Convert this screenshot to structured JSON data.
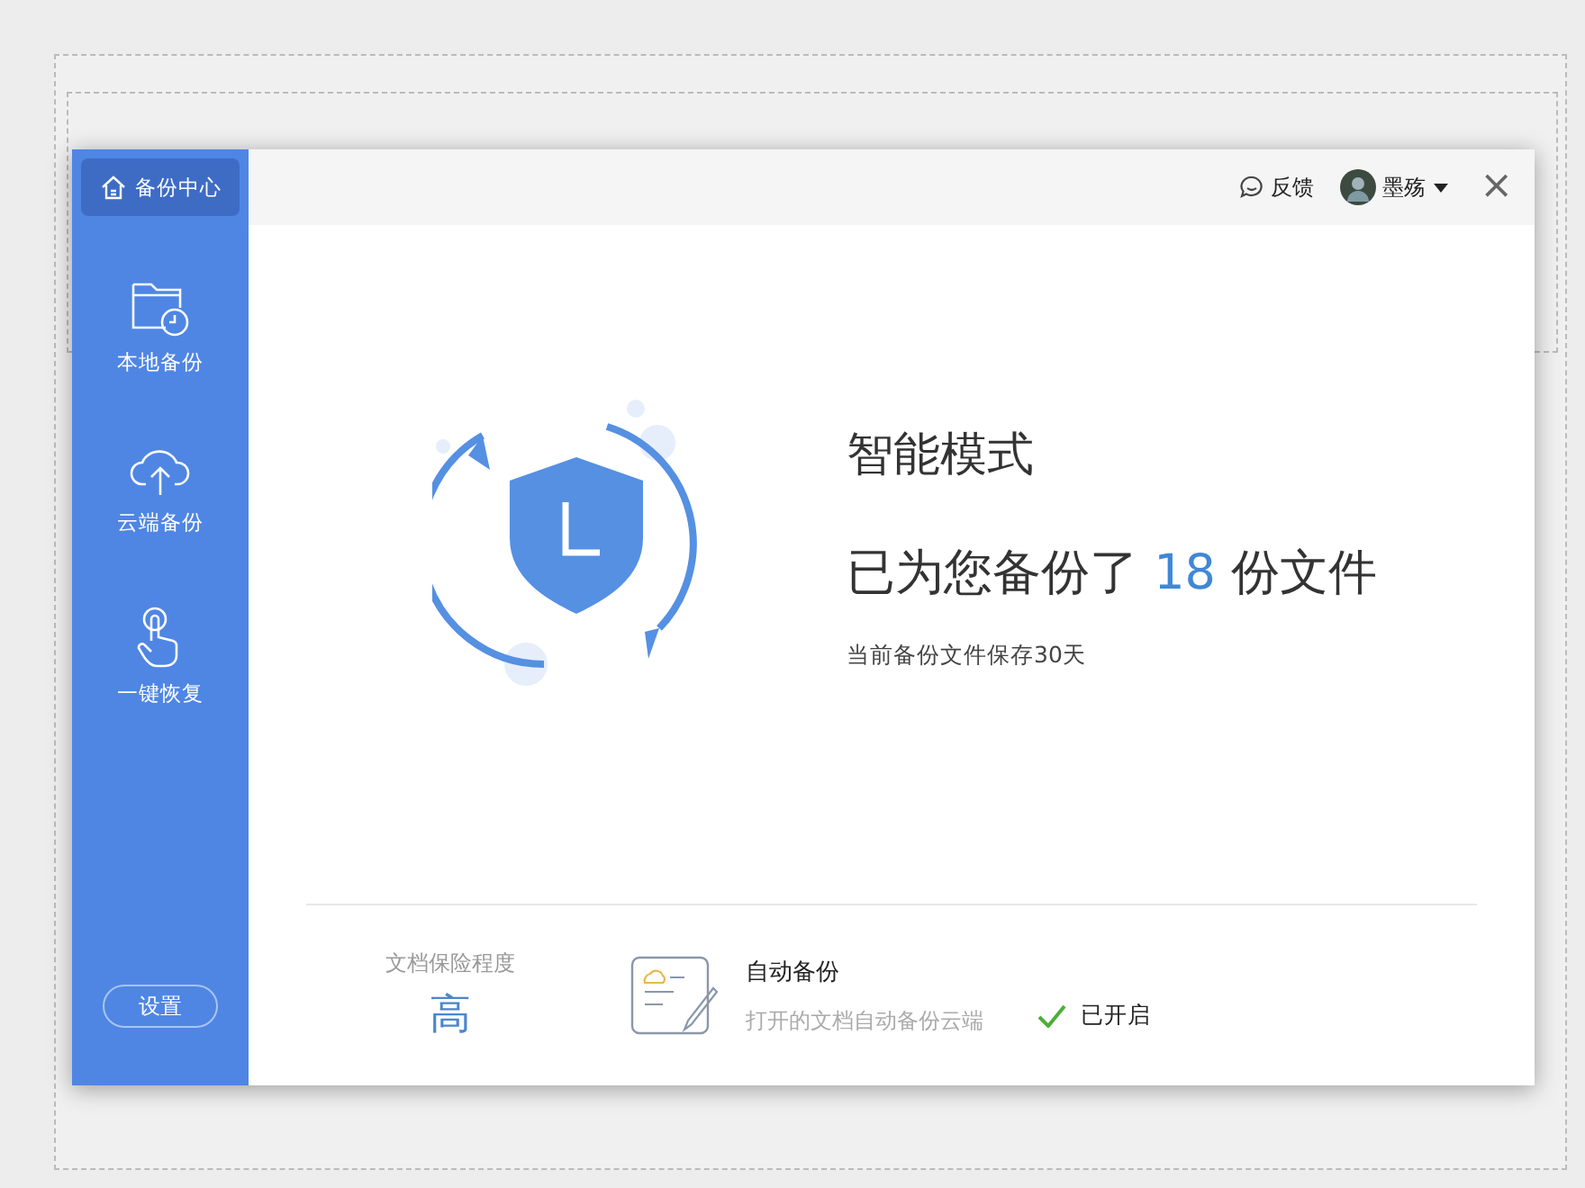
{
  "sidebar": {
    "header": {
      "label": "备份中心",
      "selected": true
    },
    "items": [
      {
        "kind": "local",
        "label": "本地备份",
        "selected": false
      },
      {
        "kind": "cloud",
        "label": "云端备份",
        "selected": false
      },
      {
        "kind": "restore",
        "label": "一键恢复",
        "selected": false
      }
    ],
    "settings_button": "设置"
  },
  "top_bar": {
    "feedback": "反馈",
    "user": "墨殇",
    "close": "×"
  },
  "status": {
    "mode": "智能模式",
    "summary_before": "已为您备份了",
    "count": "18",
    "summary_after": "份文件",
    "retention": "当前备份文件保存30天"
  },
  "protection": {
    "label": "文档保险程度",
    "value": "高"
  },
  "auto_backup": {
    "title": "自动备份",
    "description": "打开的文档自动备份云端",
    "on": true,
    "state_label": "已开启"
  }
}
